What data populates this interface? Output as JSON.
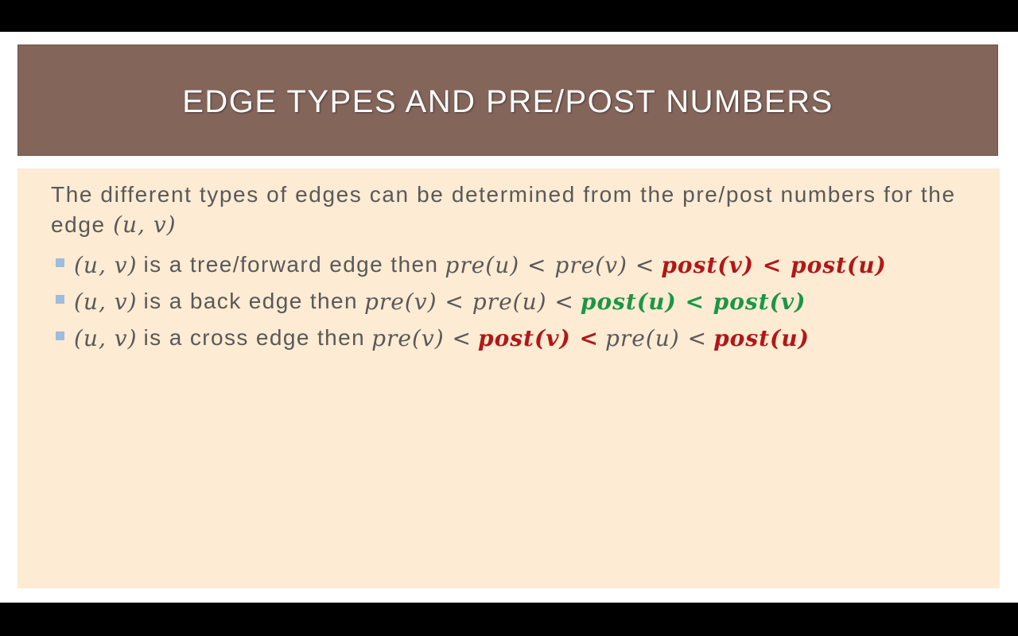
{
  "slide": {
    "title": "EDGE TYPES AND PRE/POST NUMBERS",
    "intro_text": "The different types of edges can be determined from the pre/post numbers for the edge",
    "intro_math": "(u, v)",
    "bullets": [
      {
        "subject": "(u, v)",
        "text": "is a tree/forward edge then",
        "plain_math": "pre(u) < pre(v) <",
        "highlight_math": "post(v) < post(u)",
        "highlight_color": "#b01818"
      },
      {
        "subject": "(u, v)",
        "text": "is a back edge then",
        "plain_math": "pre(v) < pre(u) <",
        "highlight_math": "post(u) < post(v)",
        "highlight_color": "#1b9646"
      },
      {
        "subject": "(u, v)",
        "text": "is a cross edge then",
        "math_parts": [
          "pre(v) <",
          "post(v) <",
          "pre(u) <",
          "post(u)"
        ]
      }
    ]
  },
  "colors": {
    "title_bar": "#84655a",
    "content_bg": "#fdebd3",
    "body_text": "#595959",
    "bullet_marker": "#9dbce0"
  }
}
